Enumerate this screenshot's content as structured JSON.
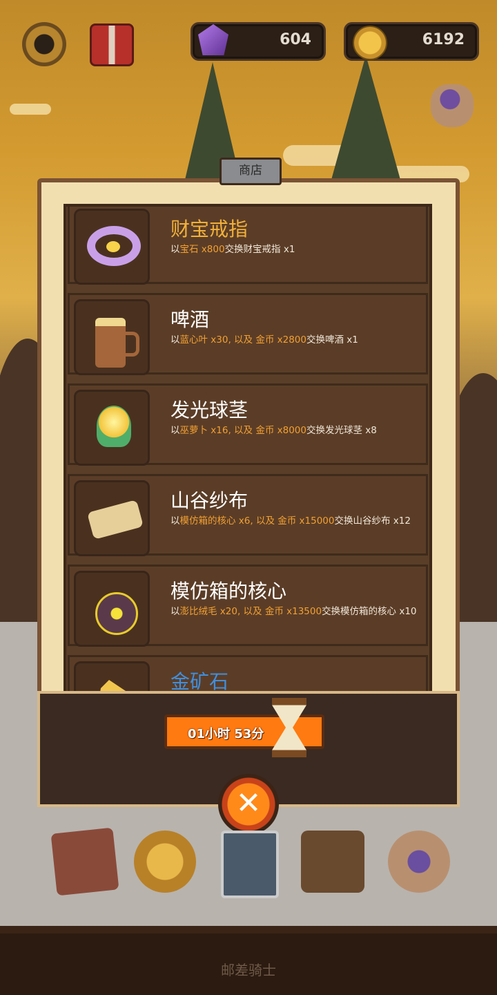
{
  "header": {
    "gems": "604",
    "coins": "6192"
  },
  "shop": {
    "tab_label": "商店",
    "items": [
      {
        "name": "财宝戒指",
        "desc_parts": [
          "以",
          "宝石 x800",
          "交换财宝戒指 x1"
        ],
        "icon": "ring-icon",
        "name_color": "#f2b13a"
      },
      {
        "name": "啤酒",
        "desc_parts": [
          "以",
          "蓝心叶 x30, 以及 金币 x2800",
          "交换啤酒 x1"
        ],
        "icon": "beer-icon",
        "name_color": "#ffffff"
      },
      {
        "name": "发光球茎",
        "desc_parts": [
          "以",
          "巫萝卜 x16, 以及 金币 x8000",
          "交换发光球茎 x8"
        ],
        "icon": "glowing-bulb-icon",
        "name_color": "#ffffff"
      },
      {
        "name": "山谷纱布",
        "desc_parts": [
          "以",
          "模仿箱的核心 x6, 以及 金币 x15000",
          "交换山谷纱布 x12"
        ],
        "icon": "scroll-cloth-icon",
        "name_color": "#ffffff"
      },
      {
        "name": "模仿箱的核心",
        "desc_parts": [
          "以",
          "澎比绒毛 x20, 以及 金币 x13500",
          "交换模仿箱的核心 x10"
        ],
        "icon": "mimic-core-icon",
        "name_color": "#ffffff"
      },
      {
        "name": "金矿石",
        "desc_parts": [
          "",
          "",
          ""
        ],
        "icon": "gold-ore-icon",
        "name_color": "#3f8fe0"
      }
    ]
  },
  "timer": {
    "text": "01小时 53分"
  },
  "close_label": "✕",
  "bottom": {
    "label": "邮差骑士"
  }
}
